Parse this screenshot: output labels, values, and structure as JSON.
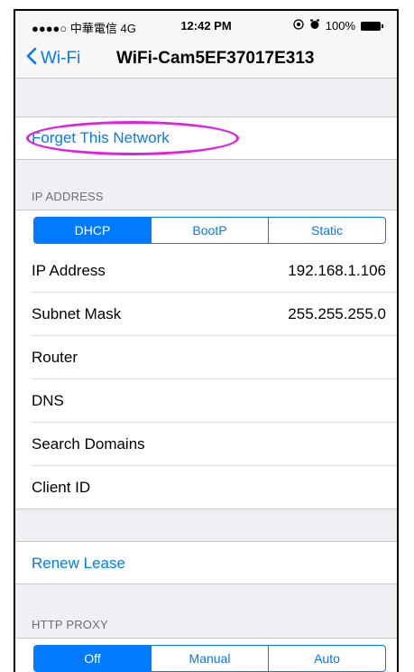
{
  "status_bar": {
    "carrier": "●●●●○ 中華電信  4G",
    "time": "12:42 PM",
    "battery": "100%",
    "icons": [
      "location-icon",
      "alarm-icon",
      "battery-icon"
    ]
  },
  "nav": {
    "back_label": "Wi-Fi",
    "title": "WiFi-Cam5EF37017E313"
  },
  "forget_label": "Forget This Network",
  "ip_section": {
    "header": "IP ADDRESS",
    "segments": [
      "DHCP",
      "BootP",
      "Static"
    ],
    "selected": "DHCP",
    "rows": [
      {
        "label": "IP Address",
        "value": "192.168.1.106"
      },
      {
        "label": "Subnet Mask",
        "value": "255.255.255.0"
      },
      {
        "label": "Router",
        "value": ""
      },
      {
        "label": "DNS",
        "value": ""
      },
      {
        "label": "Search Domains",
        "value": ""
      },
      {
        "label": "Client ID",
        "value": ""
      }
    ]
  },
  "renew_label": "Renew Lease",
  "proxy_section": {
    "header": "HTTP PROXY",
    "segments": [
      "Off",
      "Manual",
      "Auto"
    ],
    "selected": "Off"
  },
  "colors": {
    "accent": "#007aff",
    "highlight_ellipse": "#e020e0",
    "background": "#efeff4"
  }
}
